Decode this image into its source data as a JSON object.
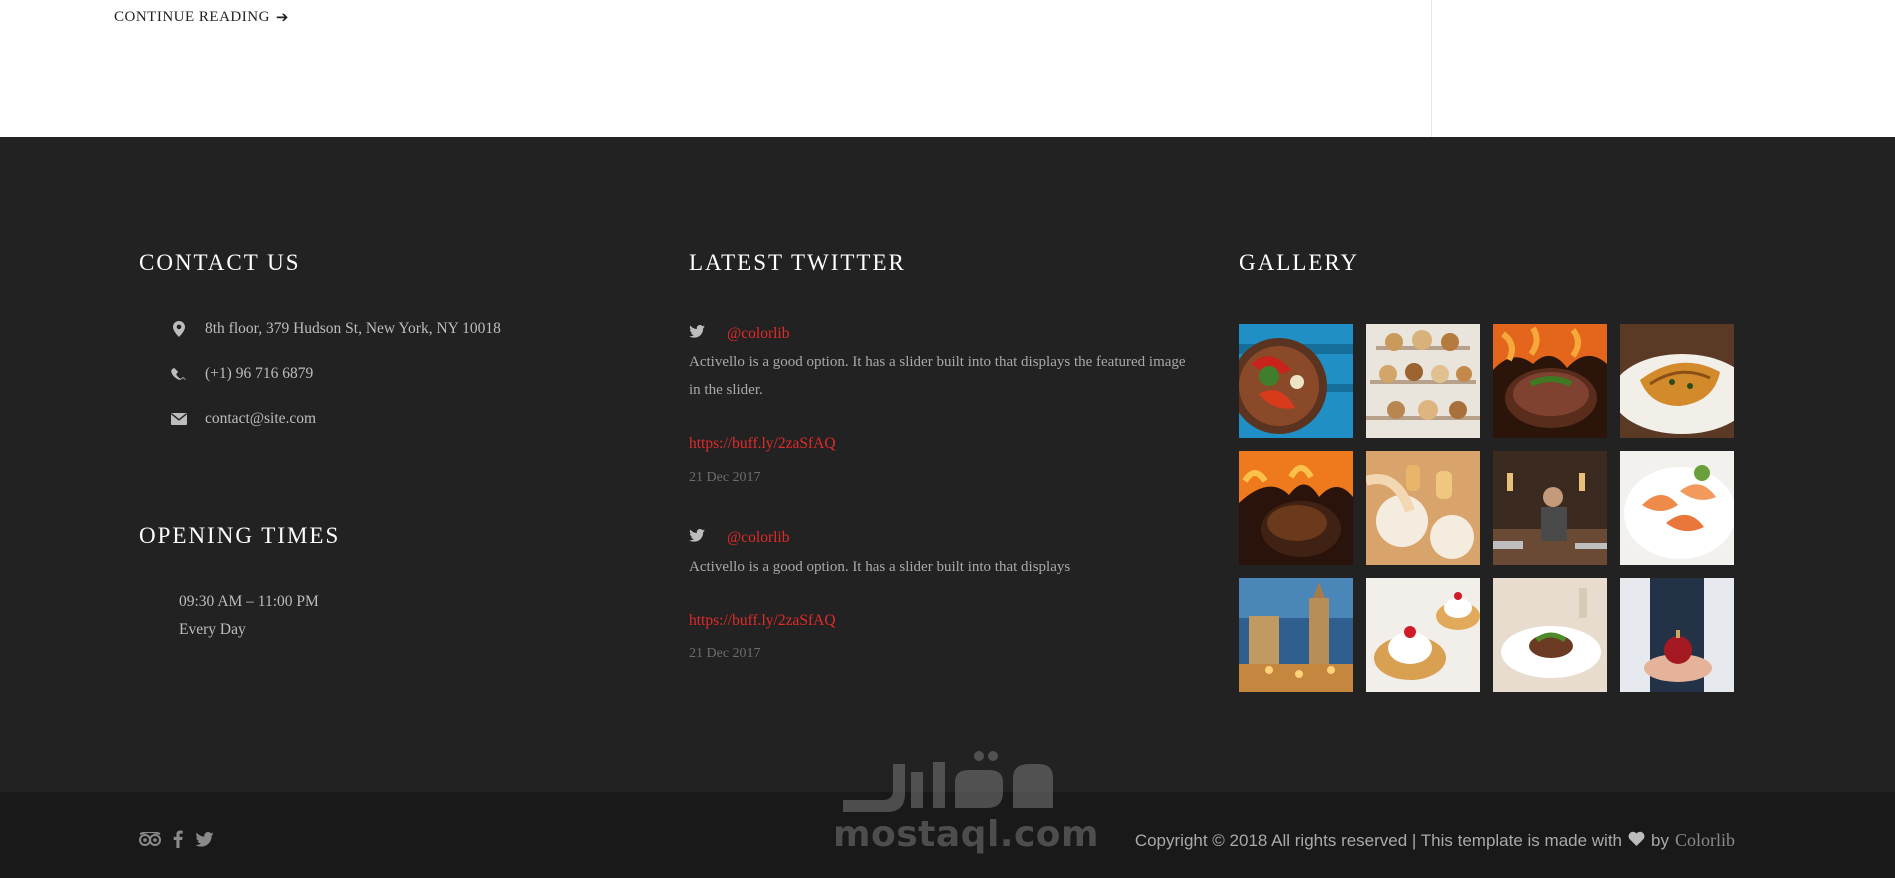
{
  "top": {
    "continue_label": "CONTINUE READING",
    "continue_arrow": "➔"
  },
  "contact": {
    "title": "CONTACT US",
    "items": [
      {
        "icon": "map-marker-icon",
        "text": "8th floor, 379 Hudson St, New York, NY 10018"
      },
      {
        "icon": "phone-icon",
        "text": "(+1) 96 716 6879"
      },
      {
        "icon": "envelope-icon",
        "text": "contact@site.com"
      }
    ]
  },
  "opening": {
    "title": "OPENING TIMES",
    "hours": "09:30 AM – 11:00 PM",
    "days": "Every Day"
  },
  "twitter": {
    "title": "LATEST TWITTER",
    "tweets": [
      {
        "handle": "@colorlib",
        "text": "Activello is a good option. It has a slider built into that displays the featured image in the slider.",
        "link": "https://buff.ly/2zaSfAQ",
        "date": "21 Dec 2017"
      },
      {
        "handle": "@colorlib",
        "text": "Activello is a good option. It has a slider built into that displays",
        "link": "https://buff.ly/2zaSfAQ",
        "date": "21 Dec 2017"
      }
    ]
  },
  "gallery": {
    "title": "GALLERY",
    "images": [
      "chili-peppers-plate",
      "pastry-tiers",
      "grilled-steak",
      "fish-fillet-plate",
      "roast-over-fire",
      "dinner-table-wine",
      "kitchen-chef",
      "shrimp-plate",
      "evening-city-street",
      "cherry-cream-dessert",
      "plated-meal",
      "hands-holding-ornament"
    ]
  },
  "footer": {
    "copyright": "Copyright © 2018 All rights reserved | This template is made with",
    "by": "by",
    "brand": "Colorlib",
    "social": [
      "tripadvisor-icon",
      "facebook-icon",
      "twitter-icon"
    ]
  },
  "watermark": {
    "arabic": "مستقل",
    "latin": "mostaql.com"
  },
  "colors": {
    "accent": "#e32a2a",
    "footer_bg": "#222222",
    "bottom_bar_bg": "#191919"
  }
}
